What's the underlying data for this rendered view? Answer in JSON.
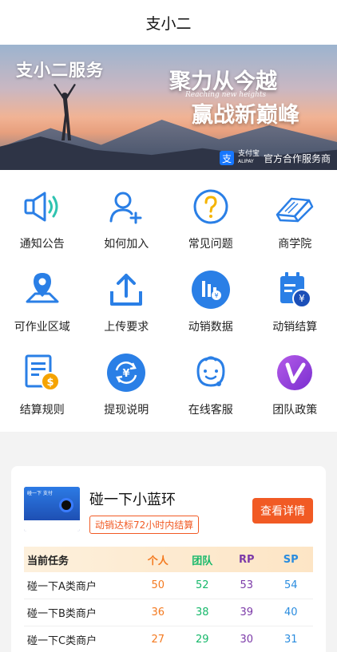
{
  "header": {
    "title": "支小二"
  },
  "banner": {
    "title_left": "支小二服务",
    "slogan_line1": "聚力从今越",
    "slogan_sub": "Reaching new heights",
    "slogan_line2": "赢战新巅峰",
    "alipay_name": "支付宝",
    "alipay_en": "ALIPAY",
    "partner_text": "官方合作服务商"
  },
  "grid": {
    "items": [
      {
        "label": "通知公告",
        "icon": "speaker-icon"
      },
      {
        "label": "如何加入",
        "icon": "add-user-icon"
      },
      {
        "label": "常见问题",
        "icon": "question-icon"
      },
      {
        "label": "商学院",
        "icon": "book-icon"
      },
      {
        "label": "可作业区域",
        "icon": "map-pin-icon"
      },
      {
        "label": "上传要求",
        "icon": "upload-icon"
      },
      {
        "label": "动销数据",
        "icon": "bar-chart-icon"
      },
      {
        "label": "动销结算",
        "icon": "calendar-yen-icon"
      },
      {
        "label": "结算规则",
        "icon": "document-dollar-icon"
      },
      {
        "label": "提现说明",
        "icon": "yen-cycle-icon"
      },
      {
        "label": "在线客服",
        "icon": "support-face-icon"
      },
      {
        "label": "团队政策",
        "icon": "v-badge-icon"
      }
    ]
  },
  "promo": {
    "title": "碰一下小蓝环",
    "tag": "动销达标72小时内结算",
    "button": "查看详情",
    "thumb_text": "碰一下 支付"
  },
  "table": {
    "headers": [
      "当前任务",
      "个人",
      "团队",
      "RP",
      "SP"
    ],
    "rows": [
      {
        "task": "碰一下A类商户",
        "personal": "50",
        "team": "52",
        "rp": "53",
        "sp": "54"
      },
      {
        "task": "碰一下B类商户",
        "personal": "36",
        "team": "38",
        "rp": "39",
        "sp": "40"
      },
      {
        "task": "碰一下C类商户",
        "personal": "27",
        "team": "29",
        "rp": "30",
        "sp": "31"
      }
    ]
  },
  "colors": {
    "accent": "#f15a24",
    "blue": "#2a7fe6",
    "purple": "#8b3fd6"
  }
}
